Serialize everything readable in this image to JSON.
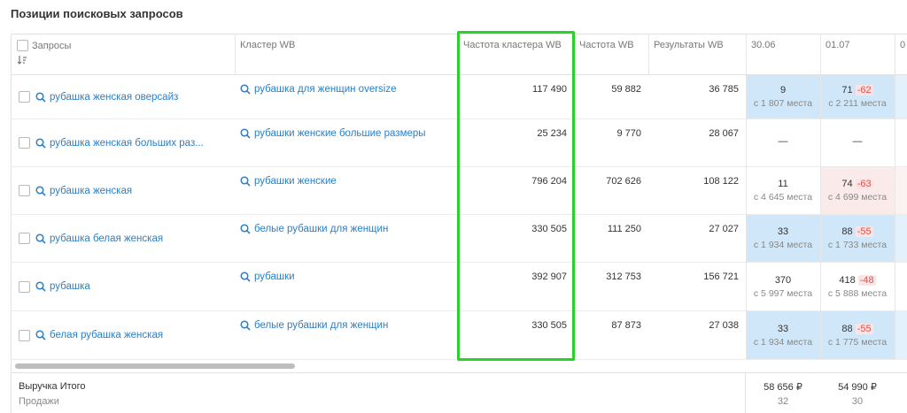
{
  "page_title": "Позиции поисковых запросов",
  "columns": {
    "queries": "Запросы",
    "cluster": "Кластер WB",
    "cluster_freq": "Частота кластера WB",
    "freq": "Частота WB",
    "results": "Результаты WB",
    "date1": "30.06",
    "date2": "01.07",
    "date3": "0"
  },
  "rows": [
    {
      "query": "рубашка женская оверсайз",
      "cluster": "рубашка для женщин oversize",
      "cluster_freq": "117 490",
      "freq": "59 882",
      "results": "36 785",
      "d1_main": "9",
      "d1_sub": "с 1 807 места",
      "d1_delta": "",
      "d1_bg": "blue",
      "d2_main": "71",
      "d2_delta": "-62",
      "d2_sub": "с 2 211 места",
      "d2_bg": "blue"
    },
    {
      "query": "рубашка женская больших раз...",
      "cluster": "рубашки женские большие размеры",
      "cluster_freq": "25 234",
      "freq": "9 770",
      "results": "28 067",
      "d1_main": "—",
      "d1_sub": "",
      "d1_delta": "",
      "d1_bg": "none",
      "d2_main": "—",
      "d2_delta": "",
      "d2_sub": "",
      "d2_bg": "none"
    },
    {
      "query": "рубашка женская",
      "cluster": "рубашки женские",
      "cluster_freq": "796 204",
      "freq": "702 626",
      "results": "108 122",
      "d1_main": "11",
      "d1_sub": "с 4 645 места",
      "d1_delta": "",
      "d1_bg": "none",
      "d2_main": "74",
      "d2_delta": "-63",
      "d2_sub": "с 4 699 места",
      "d2_bg": "pink"
    },
    {
      "query": "рубашка белая женская",
      "cluster": "белые рубашки для женщин",
      "cluster_freq": "330 505",
      "freq": "111 250",
      "results": "27 027",
      "d1_main": "33",
      "d1_sub": "с 1 934 места",
      "d1_delta": "",
      "d1_bg": "blue",
      "d2_main": "88",
      "d2_delta": "-55",
      "d2_sub": "с 1 733 места",
      "d2_bg": "blue"
    },
    {
      "query": "рубашка",
      "cluster": "рубашки",
      "cluster_freq": "392 907",
      "freq": "312 753",
      "results": "156 721",
      "d1_main": "370",
      "d1_sub": "с 5 997 места",
      "d1_delta": "",
      "d1_bg": "none",
      "d2_main": "418",
      "d2_delta": "-48",
      "d2_sub": "с 5 888 места",
      "d2_bg": "none"
    },
    {
      "query": "белая рубашка женская",
      "cluster": "белые рубашки для женщин",
      "cluster_freq": "330 505",
      "freq": "87 873",
      "results": "27 038",
      "d1_main": "33",
      "d1_sub": "с 1 934 места",
      "d1_delta": "",
      "d1_bg": "blue",
      "d2_main": "88",
      "d2_delta": "-55",
      "d2_sub": "с 1 775 места",
      "d2_bg": "blue"
    }
  ],
  "footer": {
    "revenue_label": "Выручка Итого",
    "sales_label": "Продажи",
    "d1_revenue": "58 656 ₽",
    "d1_sales": "32",
    "d2_revenue": "54 990 ₽",
    "d2_sales": "30"
  },
  "colors": {
    "highlight": "#2ad12a",
    "link": "#2a7fc8",
    "positive_bg": "#cfe7f8",
    "negative_bg": "#fbeaea",
    "delta": "#d9534f"
  }
}
